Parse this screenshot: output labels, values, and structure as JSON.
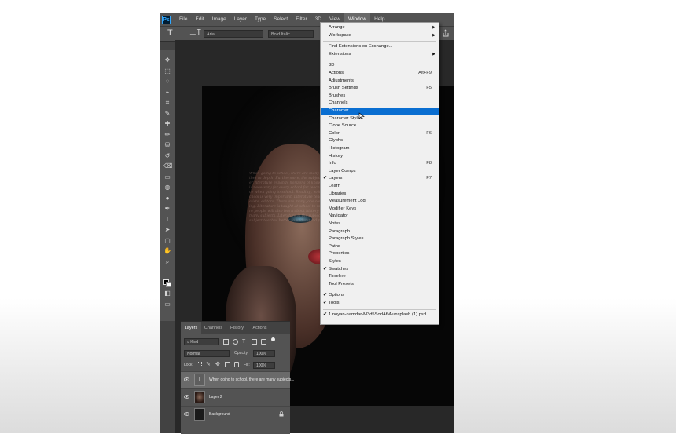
{
  "menubar": {
    "logo": "Ps",
    "items": [
      "File",
      "Edit",
      "Image",
      "Layer",
      "Type",
      "Select",
      "Filter",
      "3D",
      "View",
      "Window",
      "Help"
    ],
    "active_index": 9
  },
  "options_bar": {
    "tool_glyph": "T",
    "orientation_glyph": "⊥T",
    "font_family": "Arial",
    "font_style": "Bold Italic"
  },
  "tools": [
    "move-tool",
    "marquee-tool",
    "lasso-tool",
    "quick-select-tool",
    "crop-tool",
    "eyedropper-tool",
    "healing-brush-tool",
    "brush-tool",
    "clone-stamp-tool",
    "history-brush-tool",
    "eraser-tool",
    "gradient-tool",
    "blur-tool",
    "dodge-tool",
    "pen-tool",
    "type-tool",
    "path-selection-tool",
    "shape-tool",
    "hand-tool",
    "zoom-tool",
    "more-tools",
    "color-swatches",
    "quick-mask",
    "screen-mode"
  ],
  "window_menu": {
    "items": [
      {
        "label": "Arrange",
        "submenu": true
      },
      {
        "label": "Workspace",
        "submenu": true
      },
      {
        "sep": true
      },
      {
        "label": "Find Extensions on Exchange..."
      },
      {
        "label": "Extensions",
        "submenu": true
      },
      {
        "sep": true
      },
      {
        "label": "3D"
      },
      {
        "label": "Actions",
        "shortcut": "Alt+F9"
      },
      {
        "label": "Adjustments"
      },
      {
        "label": "Brush Settings",
        "shortcut": "F5"
      },
      {
        "label": "Brushes"
      },
      {
        "label": "Channels"
      },
      {
        "label": "Character",
        "highlighted": true
      },
      {
        "label": "Character Styles"
      },
      {
        "label": "Clone Source"
      },
      {
        "label": "Color",
        "shortcut": "F6"
      },
      {
        "label": "Glyphs"
      },
      {
        "label": "Histogram"
      },
      {
        "label": "History"
      },
      {
        "label": "Info",
        "shortcut": "F8"
      },
      {
        "label": "Layer Comps"
      },
      {
        "label": "Layers",
        "shortcut": "F7",
        "checked": true
      },
      {
        "label": "Learn"
      },
      {
        "label": "Libraries"
      },
      {
        "label": "Measurement Log"
      },
      {
        "label": "Modifier Keys"
      },
      {
        "label": "Navigator"
      },
      {
        "label": "Notes"
      },
      {
        "label": "Paragraph"
      },
      {
        "label": "Paragraph Styles"
      },
      {
        "label": "Paths"
      },
      {
        "label": "Properties"
      },
      {
        "label": "Styles"
      },
      {
        "label": "Swatches",
        "checked": true
      },
      {
        "label": "Timeline"
      },
      {
        "label": "Tool Presets"
      },
      {
        "sep": true
      },
      {
        "label": "Options",
        "checked": true
      },
      {
        "label": "Tools",
        "checked": true
      },
      {
        "sep": true
      },
      {
        "label": "1 noyan-namdar-M3d5SodAfM-unsplash (1).psd",
        "checked": true
      }
    ]
  },
  "canvas": {
    "overlay_text": "When going to school, there are many subjects. Literature is the subject teaching further in depth. Furthermore, the subject teaches better to understand people. Moreover, literature expands horizons of knowledge. Literature is the history of literature, it is necessary for every school for teaching the subject. Literature is of great importance when going to school. Reading, writing, learning and understanding literature at school is very important. Literature teaches us to become better people, such as journalists, editors. There are many jobs connected with literature, not only limited to writing. Literature is taught at school to understand further more, when learning literature people will also learn about history and culture. When going to school, there are many subjects. Literature is the subject teaching further in depth. Furthermore, the subject teaches better to understand people."
  },
  "layers_panel": {
    "tabs": [
      "Layers",
      "Channels",
      "History",
      "Actions"
    ],
    "active_tab": 0,
    "kind_filter": "Kind",
    "blend_mode": "Normal",
    "opacity_label": "Opacity:",
    "opacity_value": "100%",
    "lock_label": "Lock:",
    "fill_label": "Fill:",
    "fill_value": "100%",
    "layers": [
      {
        "name": "When going to school, there are many subjects...",
        "type": "text",
        "selected": true,
        "thumb_glyph": "T"
      },
      {
        "name": "Layer 2",
        "type": "photo",
        "selected": false
      },
      {
        "name": "Background",
        "type": "fill",
        "selected": false,
        "locked": true
      }
    ]
  },
  "colors": {
    "menu_highlight": "#0a6ed1",
    "app_bg": "#424242",
    "panel_bg": "#535353"
  }
}
